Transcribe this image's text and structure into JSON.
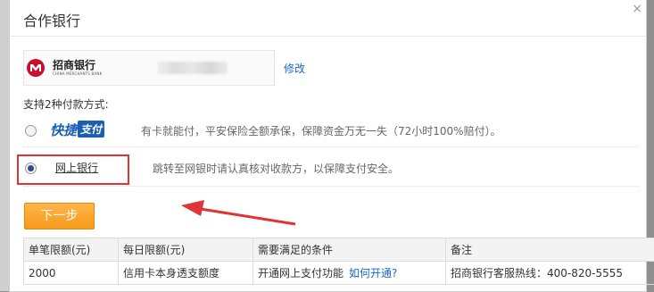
{
  "dialog": {
    "title": "合作银行",
    "close_glyph": "×"
  },
  "bank": {
    "name_cn": "招商银行",
    "name_en": "CHINA MERCHANTS BANK",
    "modify_label": "修改"
  },
  "payment": {
    "methods_label": "支持2种付款方式:",
    "kuaijie": {
      "logo_part1": "快捷",
      "logo_part2": "支付",
      "description": "有卡就能付，平安保险全额承保，保障资金万无一失（72小时100%赔付）。",
      "selected": false
    },
    "netbank": {
      "label": "网上银行",
      "description": "跳转至网银时请认真核对收款方，以保障支付安全。",
      "selected": true
    }
  },
  "next_button_label": "下一步",
  "limits_table": {
    "headers": [
      "单笔限额(元)",
      "每日限额(元)",
      "需要满足的条件",
      "备注"
    ],
    "row": {
      "single_limit": "2000",
      "daily_limit": "信用卡本身透支额度",
      "condition": "开通网上支付功能",
      "condition_link": "如何开通?",
      "note": "招商银行客服热线：400-820-5555"
    }
  },
  "colors": {
    "link": "#1b66c9",
    "highlight": "#e03535",
    "button": "#f79a1a",
    "cmb_red": "#c8102e"
  }
}
